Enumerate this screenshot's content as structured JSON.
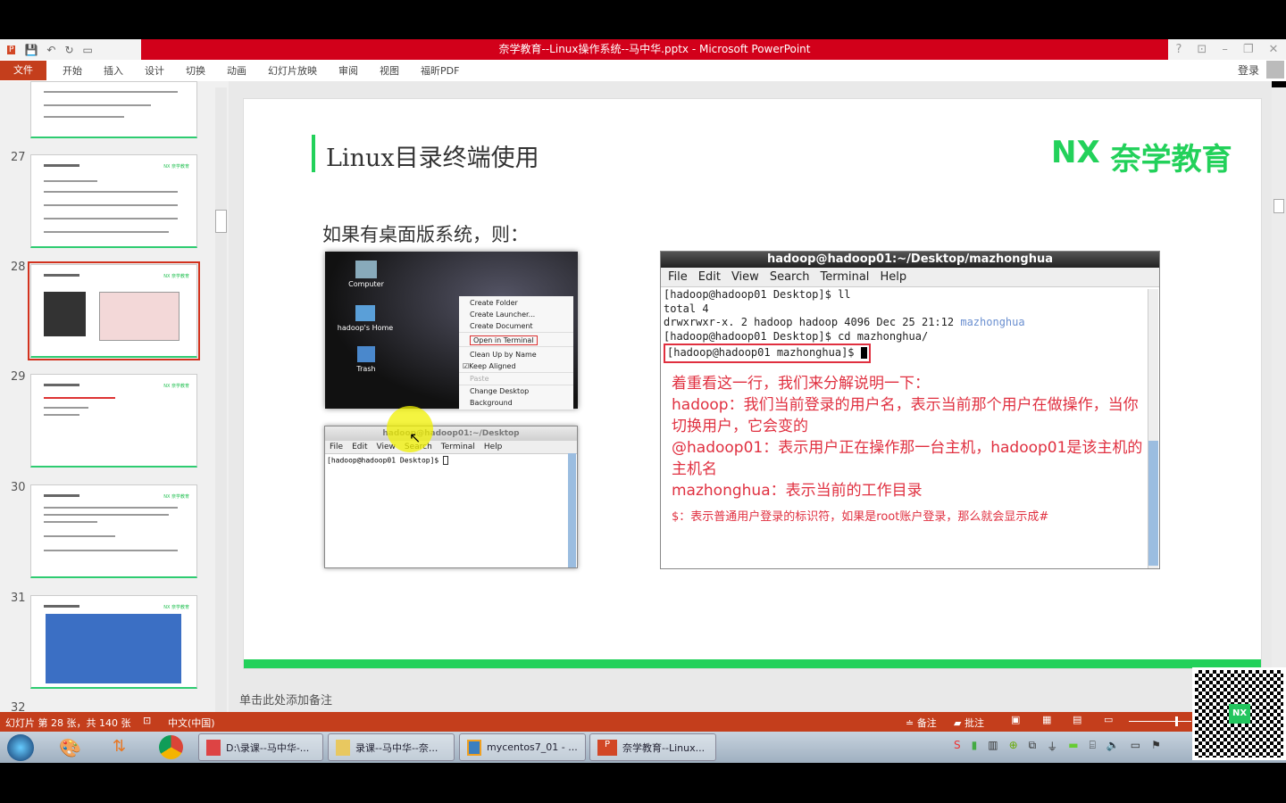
{
  "window": {
    "title": "奈学教育--Linux操作系统--马中华.pptx - Microsoft PowerPoint",
    "controls": [
      "?",
      "⊡",
      "–",
      "❐",
      "✕"
    ]
  },
  "ribbon": {
    "tabs": [
      "文件",
      "开始",
      "插入",
      "设计",
      "切换",
      "动画",
      "幻灯片放映",
      "审阅",
      "视图",
      "福昕PDF"
    ],
    "login": "登录"
  },
  "thumbnails": [
    {
      "num": "27"
    },
    {
      "num": "28",
      "selected": true
    },
    {
      "num": "29"
    },
    {
      "num": "30"
    },
    {
      "num": "31"
    },
    {
      "num": "32"
    }
  ],
  "thumb_logo": "NX 奈学教育",
  "slide": {
    "title": "Linux目录终端使用",
    "logo_mark": "NX",
    "logo_text": "奈学教育",
    "subtitle": "如果有桌面版系统，则：",
    "desktop": {
      "icons": [
        "Computer",
        "hadoop's Home",
        "Trash"
      ],
      "menu": [
        "Create Folder",
        "Create Launcher...",
        "Create Document",
        "Open in Terminal",
        "Clean Up by Name",
        "Keep Aligned",
        "Paste",
        "Change Desktop Background"
      ]
    },
    "small_terminal": {
      "title": "hadoop@hadoop01:~/Desktop",
      "menu": [
        "File",
        "Edit",
        "View",
        "Search",
        "Terminal",
        "Help"
      ],
      "line": "[hadoop@hadoop01 Desktop]$ "
    },
    "big_terminal": {
      "title": "hadoop@hadoop01:~/Desktop/mazhonghua",
      "menu": [
        "File",
        "Edit",
        "View",
        "Search",
        "Terminal",
        "Help"
      ],
      "lines": [
        "[hadoop@hadoop01 Desktop]$ ll",
        "total 4",
        "drwxrwxr-x. 2 hadoop hadoop 4096 Dec 25 21:12 ",
        "[hadoop@hadoop01 Desktop]$ cd mazhonghua/"
      ],
      "dir_name": "mazhonghua",
      "prompt": "[hadoop@hadoop01 mazhonghua]$ ",
      "notes": [
        "着重看这一行，我们来分解说明一下：",
        "hadoop：我们当前登录的用户名，表示当前那个用户在做操作，当你切换用户，它会变的",
        "@hadoop01：表示用户正在操作那一台主机，hadoop01是该主机的主机名",
        "mazhonghua：表示当前的工作目录"
      ],
      "footnote": "$：表示普通用户登录的标识符，如果是root账户登录，那么就会显示成#"
    }
  },
  "notes_placeholder": "单击此处添加备注",
  "status": {
    "slide_info": "幻灯片 第 28 张，共 140 张",
    "language": "中文(中国)",
    "notes": "备注",
    "comments": "批注"
  },
  "taskbar": {
    "items": [
      "D:\\录课--马中华-...",
      "录课--马中华--奈...",
      "mycentos7_01 - ...",
      "奈学教育--Linux..."
    ]
  },
  "colors": {
    "accent": "#c43e1c",
    "title_red": "#d2001a",
    "brand_green": "#22d15a",
    "annotation_red": "#e03040"
  }
}
